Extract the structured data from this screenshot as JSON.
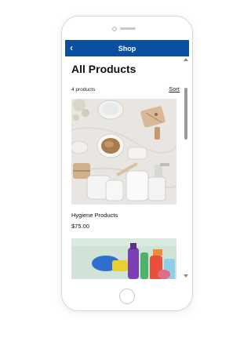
{
  "navbar": {
    "title": "Shop",
    "back_icon": "chevron-left-icon",
    "back_glyph": "‹",
    "color": "#0a4fa0"
  },
  "page": {
    "title": "All Products",
    "count": "4 products",
    "sort_label": "Sort"
  },
  "products": [
    {
      "name": "Hygiene Products",
      "price": "$75.00",
      "image": "hygiene-products-photo"
    },
    {
      "name": "",
      "price": "",
      "image": "cleaning-supplies-photo"
    }
  ]
}
